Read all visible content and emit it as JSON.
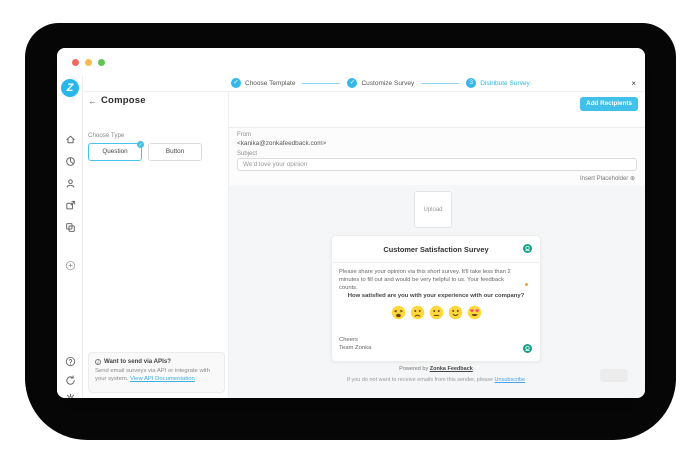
{
  "app": {
    "logo_letter": "Z"
  },
  "titlebar": {
    "lights": [
      "close",
      "minimize",
      "zoom"
    ]
  },
  "stepper": {
    "check": "✓",
    "close": "×",
    "steps": [
      {
        "label": "Choose Template",
        "status": "done"
      },
      {
        "label": "Customize Survey",
        "status": "done"
      },
      {
        "label": "Distribute Survey",
        "status": "active",
        "number": "3"
      }
    ]
  },
  "header": {
    "back_icon": "←",
    "title": "Compose",
    "add_recipients_label": "Add Recipients"
  },
  "left_panel": {
    "choose_type_label": "Choose Type",
    "type_options": [
      {
        "label": "Question",
        "selected": true
      },
      {
        "label": "Button",
        "selected": false
      }
    ],
    "selected_badge": "✓",
    "api_box": {
      "info_icon": "i",
      "title": "Want to send via APIs?",
      "body": "Send email surveys via API or integrate with your system.",
      "link": "View API Documentation"
    }
  },
  "form": {
    "from_label": "From",
    "from_value": "<kanika@zonkafeedback.com>",
    "subject_label": "Subject",
    "subject_value": "We'd love your opinion",
    "insert_placeholder_label": "Insert Placeholder ⊕"
  },
  "preview": {
    "upload_label": "Upload",
    "card": {
      "title": "Customer Satisfaction Survey",
      "intro": "Please share your opinion via this short survey. It'll take less than 2 minutes to fill out and would be very helpful to us. Your feedback counts.",
      "question": "How satisfied are you with your experience with our company?",
      "emojis": [
        "weary-face",
        "frowning-face",
        "neutral-face",
        "slightly-smiling-face",
        "heart-eyes-face"
      ],
      "signoff_line1": "Cheers",
      "signoff_line2": "Team Zonka"
    },
    "footer": {
      "powered_prefix": "Powered by ",
      "powered_brand": "Zonka Feedback",
      "unsubscribe_prefix": "If you do not want to receive emails from this sender, please ",
      "unsubscribe_link": "Unsubscribe"
    }
  },
  "sidebar": {
    "icons": [
      "zonka-logo",
      "home-icon",
      "surveys-icon",
      "contacts-icon",
      "distribute-icon",
      "templates-icon",
      "add-icon",
      "help-icon",
      "sync-icon",
      "settings-icon",
      "user-avatar"
    ]
  },
  "colors": {
    "accent_blue": "#35b8e9",
    "button_blue": "#41c0ea",
    "link_blue": "#3daee0",
    "teal_icon": "#12a184",
    "emoji_yellow": "#ffd83d",
    "marker_orange": "#f0a33a",
    "avatar_purple": "#7e82d8",
    "backdrop_black": "#070707"
  }
}
